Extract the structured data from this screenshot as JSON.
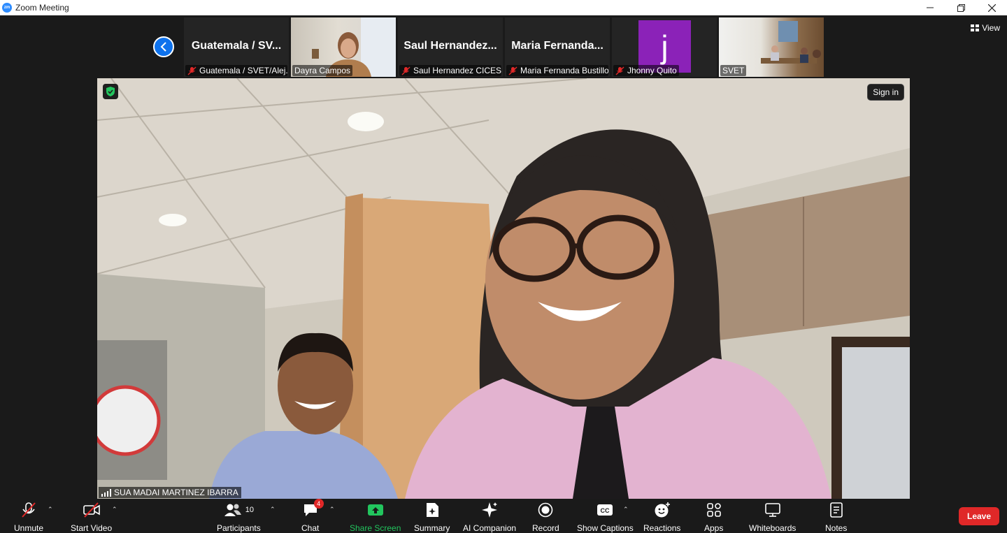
{
  "window": {
    "title": "Zoom Meeting"
  },
  "gallery": {
    "view_label": "View",
    "tiles": [
      {
        "big_name": "Guatemala / SV...",
        "label": "Guatemala / SVET/Alej...",
        "muted": true
      },
      {
        "big_name": "",
        "label": "Dayra Campos",
        "muted": false
      },
      {
        "big_name": "Saul Hernandez...",
        "label": "Saul Hernandez CICES...",
        "muted": true
      },
      {
        "big_name": "Maria Fernanda...",
        "label": "Maria Fernanda Bustillo",
        "muted": true
      },
      {
        "big_name": "",
        "avatar_letter": "j",
        "label": "Jhonny Quito",
        "muted": true
      },
      {
        "big_name": "",
        "label": "SVET",
        "muted": false
      }
    ]
  },
  "main": {
    "speaker_name": "SUA MADAI MARTINEZ IBARRA",
    "sign_in_label": "Sign in"
  },
  "toolbar": {
    "unmute": "Unmute",
    "start_video": "Start Video",
    "participants": "Participants",
    "participants_count": "10",
    "chat": "Chat",
    "chat_badge": "4",
    "share_screen": "Share Screen",
    "summary": "Summary",
    "ai_companion": "AI Companion",
    "record": "Record",
    "show_captions": "Show Captions",
    "reactions": "Reactions",
    "apps": "Apps",
    "whiteboards": "Whiteboards",
    "notes": "Notes",
    "leave": "Leave"
  },
  "colors": {
    "accent": "#0e72ed",
    "leave": "#e02828",
    "share": "#22c55e",
    "avatar_j": "#8b22b8"
  }
}
